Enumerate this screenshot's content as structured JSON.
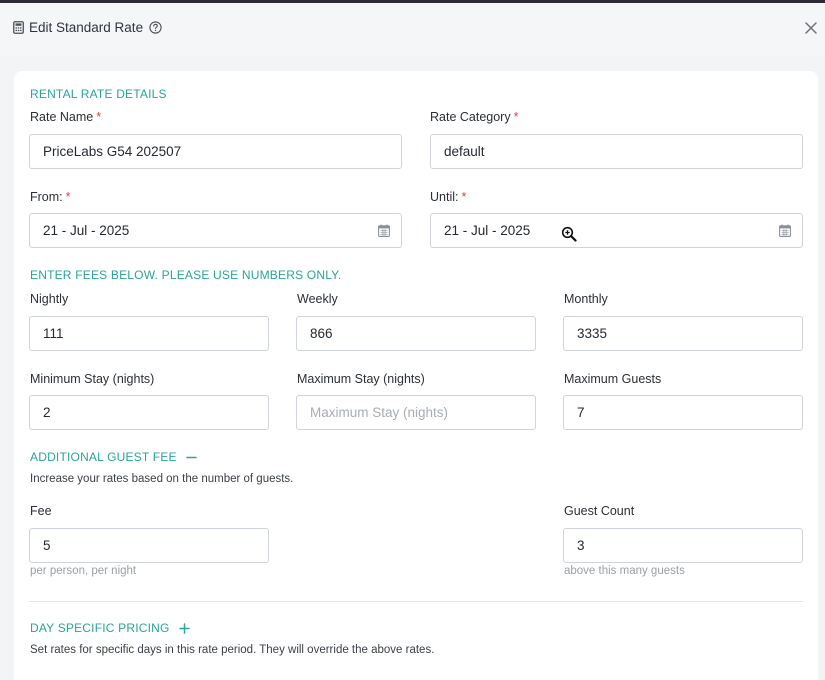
{
  "header": {
    "title": "Edit Standard Rate",
    "icon": "calculator-icon",
    "help_icon": "help-circle-icon",
    "close_icon": "close-icon"
  },
  "rental": {
    "section_title": "RENTAL RATE DETAILS",
    "rate_name_label": "Rate Name",
    "rate_name_value": "PriceLabs G54 202507",
    "rate_category_label": "Rate Category",
    "rate_category_value": "default",
    "from_label": "From:",
    "from_value": "21 - Jul - 2025",
    "until_label": "Until:",
    "until_value": "21 - Jul - 2025",
    "required_mark": "*"
  },
  "fees": {
    "section_title": "ENTER FEES BELOW. PLEASE USE NUMBERS ONLY.",
    "nightly_label": "Nightly",
    "nightly_value": "111",
    "weekly_label": "Weekly",
    "weekly_value": "866",
    "monthly_label": "Monthly",
    "monthly_value": "3335",
    "min_stay_label": "Minimum Stay (nights)",
    "min_stay_value": "2",
    "max_stay_label": "Maximum Stay (nights)",
    "max_stay_placeholder": "Maximum Stay (nights)",
    "max_guests_label": "Maximum Guests",
    "max_guests_value": "7"
  },
  "guest_fee": {
    "section_title": "ADDITIONAL GUEST FEE",
    "toggle_icon": "minus-icon",
    "description": "Increase your rates based on the number of guests.",
    "fee_label": "Fee",
    "fee_value": "5",
    "fee_helper": "per person, per night",
    "guest_count_label": "Guest Count",
    "guest_count_value": "3",
    "guest_count_helper": "above this many guests"
  },
  "day_specific": {
    "section_title": "DAY SPECIFIC PRICING",
    "toggle_icon": "plus-icon",
    "description": "Set rates for specific days in this rate period. They will override the above rates."
  },
  "colors": {
    "accent": "#2aa59a",
    "required": "#e0452d",
    "border": "#cfd3da",
    "header_bg": "#f5f6f8"
  }
}
